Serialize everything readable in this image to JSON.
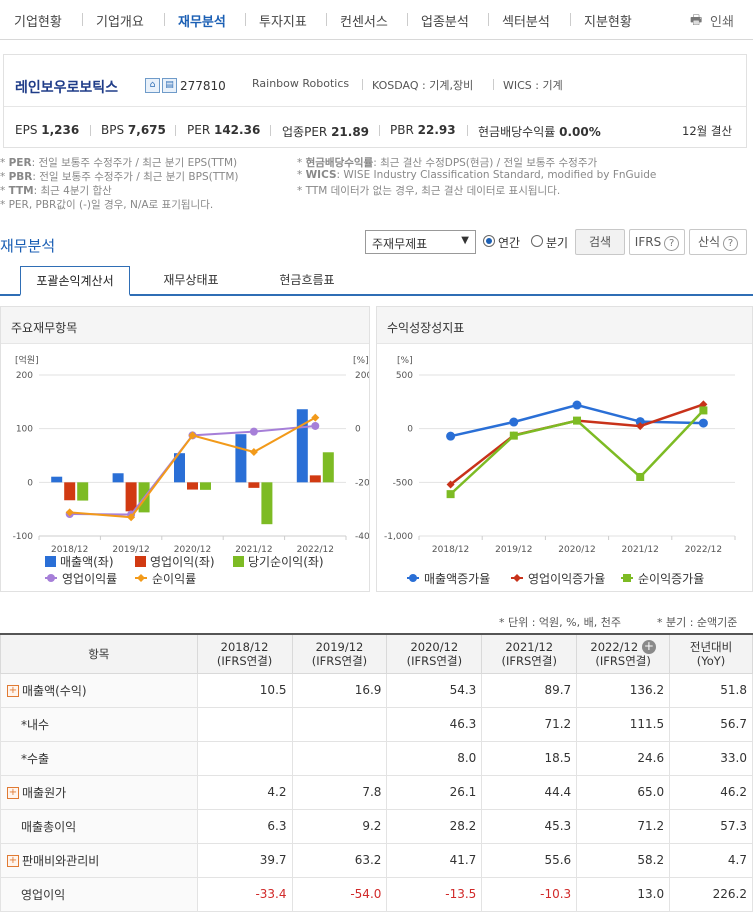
{
  "nav": {
    "tabs": [
      "기업현황",
      "기업개요",
      "재무분석",
      "투자지표",
      "컨센서스",
      "업종분석",
      "섹터분석",
      "지분현황"
    ],
    "active_index": 2,
    "print_label": "인쇄"
  },
  "company": {
    "name": "레인보우로보틱스",
    "code": "277810",
    "english_name": "Rainbow Robotics",
    "market": "KOSDAQ : 기계,장비",
    "wics": "WICS : 기계",
    "ratios": {
      "eps_label": "EPS",
      "eps": "1,236",
      "bps_label": "BPS",
      "bps": "7,675",
      "per_label": "PER",
      "per": "142.36",
      "sector_per_label": "업종PER",
      "sector_per": "21.89",
      "pbr_label": "PBR",
      "pbr": "22.93",
      "div_label": "현금배당수익률",
      "div": "0.00%"
    },
    "fiscal_month": "12월 결산"
  },
  "notes": {
    "per_key": "PER",
    "per_text": ": 전일 보통주 수정주가 / 최근 분기 EPS(TTM)",
    "pbr_key": "PBR",
    "pbr_text": ": 전일 보통주 수정주가 / 최근 분기 BPS(TTM)",
    "ttm_key": "TTM",
    "ttm_text": ": 최근 4분기 합산",
    "neg_text": "* PER, PBR값이 (-)일 경우, N/A로 표기됩니다.",
    "div_key": "현금배당수익률",
    "div_text": ": 최근 결산 수정DPS(현금) / 전일 보통주 수정주가",
    "wics_key": "WICS",
    "wics_text": ": WISE Industry Classification Standard, modified by FnGuide",
    "ttm_none_text": "* TTM 데이터가 없는 경우, 최근 결산 데이터로 표시됩니다."
  },
  "section": {
    "title": "재무분석",
    "select_value": "주재무제표",
    "radio_annual": "연간",
    "radio_quarter": "분기",
    "search_btn": "검색",
    "ifrs_btn": "IFRS",
    "calc_btn": "산식"
  },
  "subtabs": [
    "포괄손익계산서",
    "재무상태표",
    "현금흐름표"
  ],
  "charts_titles": {
    "left": "주요재무항목",
    "right": "수익성장성지표"
  },
  "chart_data": [
    {
      "type": "bar",
      "title": "주요재무항목",
      "categories": [
        "2018/12",
        "2019/12",
        "2020/12",
        "2021/12",
        "2022/12"
      ],
      "left_unit": "[억원]",
      "right_unit": "[%]",
      "ylim_left": [
        -100,
        200
      ],
      "ylim_right": [
        -400,
        200
      ],
      "left_ticks": [
        "200",
        "100",
        "0",
        "-100"
      ],
      "right_ticks": [
        "200",
        "0",
        "-200",
        "-400"
      ],
      "series": [
        {
          "name": "매출액(좌)",
          "color": "#2a6fd6",
          "values": [
            10.5,
            16.9,
            54.3,
            89.7,
            136.2
          ]
        },
        {
          "name": "영업이익(좌)",
          "color": "#d13a12",
          "values": [
            -33.4,
            -54.0,
            -13.5,
            -10.3,
            13.0
          ]
        },
        {
          "name": "당기순이익(좌)",
          "color": "#7dbb24",
          "values": [
            -34.0,
            -56.0,
            -14.0,
            -78.0,
            56.0
          ]
        }
      ],
      "lines": [
        {
          "name": "영업이익률",
          "color": "#a67fd8",
          "values": [
            -318,
            -320,
            -25,
            -11,
            10
          ]
        },
        {
          "name": "순이익률",
          "color": "#f29a1a",
          "values": [
            -312,
            -330,
            -25,
            -87,
            41
          ]
        }
      ]
    },
    {
      "type": "line",
      "title": "수익성장성지표",
      "categories": [
        "2018/12",
        "2019/12",
        "2020/12",
        "2021/12",
        "2022/12"
      ],
      "unit": "[%]",
      "ylim": [
        -1000,
        500
      ],
      "ticks": [
        "500",
        "0",
        "-500",
        "-1,000"
      ],
      "series": [
        {
          "name": "매출액증가율",
          "color": "#2a6fd6",
          "values": [
            -70,
            62,
            220,
            66,
            52
          ]
        },
        {
          "name": "영업이익증가율",
          "color": "#c8321a",
          "values": [
            -520,
            -62,
            75,
            24,
            226
          ]
        },
        {
          "name": "순이익증가율",
          "color": "#7dbb24",
          "values": [
            -610,
            -65,
            75,
            -450,
            170
          ]
        }
      ]
    }
  ],
  "table": {
    "unit_note": "* 단위 : 억원, %, 배, 천주",
    "quarter_note": "* 분기 : 순액기준",
    "item_header": "항목",
    "columns": [
      {
        "year": "2018/12",
        "basis": "(IFRS연결)"
      },
      {
        "year": "2019/12",
        "basis": "(IFRS연결)"
      },
      {
        "year": "2020/12",
        "basis": "(IFRS연결)"
      },
      {
        "year": "2021/12",
        "basis": "(IFRS연결)"
      },
      {
        "year": "2022/12",
        "basis": "(IFRS연결)"
      }
    ],
    "yoy_header": "전년대비",
    "yoy_sub": "(YoY)",
    "rows": [
      {
        "label": "매출액(수익)",
        "expand": true,
        "values": [
          "10.5",
          "16.9",
          "54.3",
          "89.7",
          "136.2"
        ],
        "yoy": "51.8"
      },
      {
        "label": "*내수",
        "expand": false,
        "values": [
          "",
          "",
          "46.3",
          "71.2",
          "111.5"
        ],
        "yoy": "56.7"
      },
      {
        "label": "*수출",
        "expand": false,
        "values": [
          "",
          "",
          "8.0",
          "18.5",
          "24.6"
        ],
        "yoy": "33.0"
      },
      {
        "label": "매출원가",
        "expand": true,
        "values": [
          "4.2",
          "7.8",
          "26.1",
          "44.4",
          "65.0"
        ],
        "yoy": "46.2"
      },
      {
        "label": "매출총이익",
        "expand": false,
        "values": [
          "6.3",
          "9.2",
          "28.2",
          "45.3",
          "71.2"
        ],
        "yoy": "57.3"
      },
      {
        "label": "판매비와관리비",
        "expand": true,
        "values": [
          "39.7",
          "63.2",
          "41.7",
          "55.6",
          "58.2"
        ],
        "yoy": "4.7"
      },
      {
        "label": "영업이익",
        "expand": false,
        "values": [
          "-33.4",
          "-54.0",
          "-13.5",
          "-10.3",
          "13.0"
        ],
        "yoy": "226.2"
      }
    ]
  }
}
